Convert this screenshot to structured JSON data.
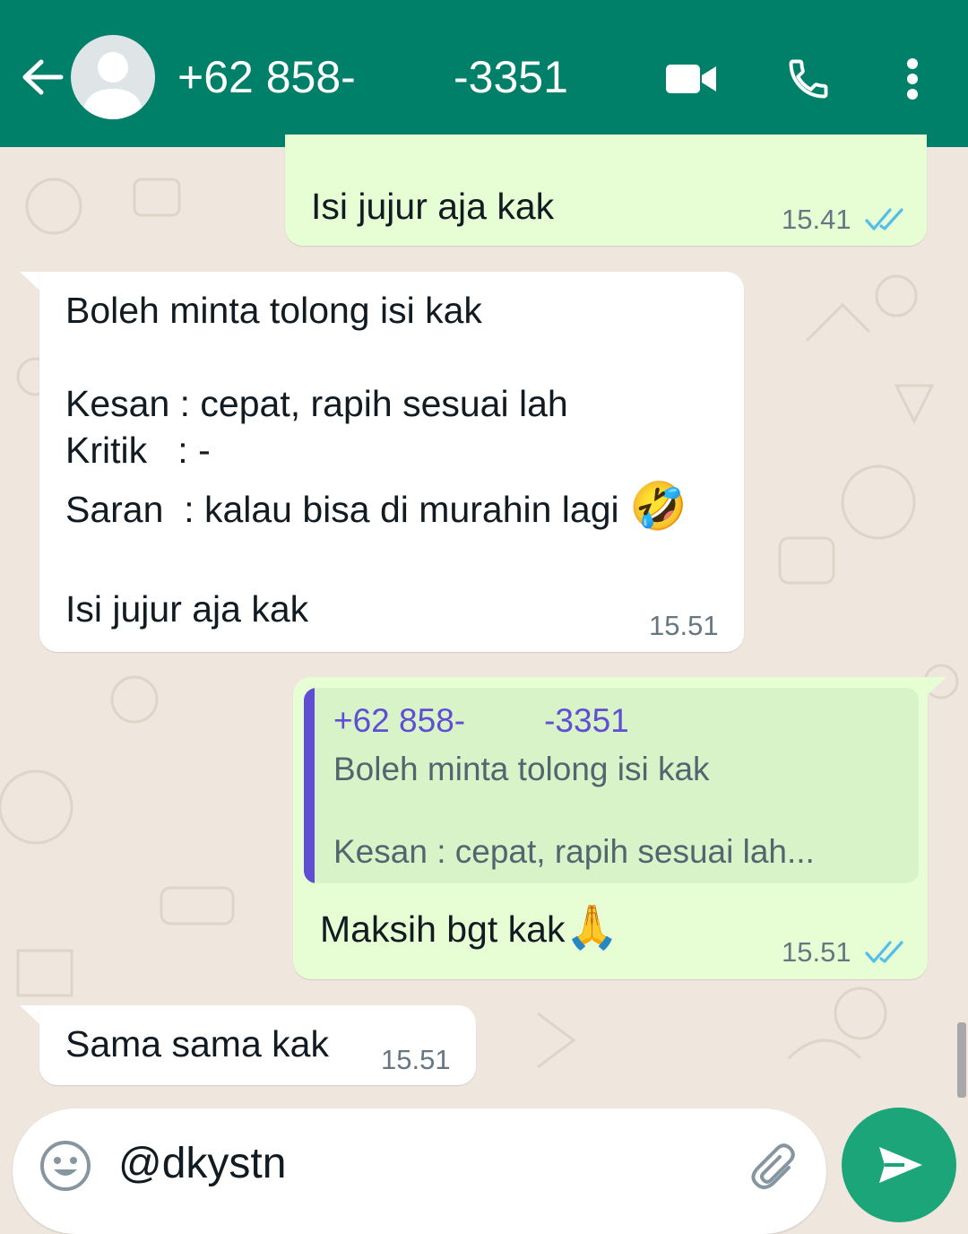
{
  "header": {
    "contact_part1": "+62 858-",
    "contact_part2": "-3351",
    "back_icon": "arrow-left-icon",
    "avatar_icon": "default-avatar-icon",
    "video_icon": "video-call-icon",
    "call_icon": "phone-icon",
    "menu_icon": "more-vert-icon"
  },
  "messages": [
    {
      "direction": "outgoing",
      "text": "Isi jujur aja kak",
      "time": "15.41",
      "status": "read"
    },
    {
      "direction": "incoming",
      "line1": "Boleh minta tolong isi kak",
      "line2": "Kesan : cepat, rapih sesuai lah",
      "line3": "Kritik   : -",
      "line4": "Saran  : kalau bisa di murahin lagi",
      "line4_emoji": "🤣",
      "line5": "Isi jujur aja kak",
      "time": "15.51"
    },
    {
      "direction": "outgoing",
      "quote": {
        "name_part1": "+62 858-",
        "name_part2": "-3351",
        "line1": "Boleh minta tolong isi kak",
        "line2": "Kesan : cepat, rapih sesuai lah..."
      },
      "text": "Maksih bgt kak",
      "emoji": "🙏",
      "time": "15.51",
      "status": "read"
    },
    {
      "direction": "incoming",
      "text": "Sama sama kak",
      "time": "15.51"
    }
  ],
  "composer": {
    "value": "@dkystn",
    "emoji_icon": "emoji-icon",
    "attach_icon": "paperclip-icon",
    "send_icon": "send-icon"
  },
  "colors": {
    "header": "#008069",
    "outgoing_bubble": "#e7fed4",
    "incoming_bubble": "#ffffff",
    "read_tick": "#53bdeb",
    "quote_accent": "#5f4ed3",
    "send_button": "#1da57a"
  }
}
